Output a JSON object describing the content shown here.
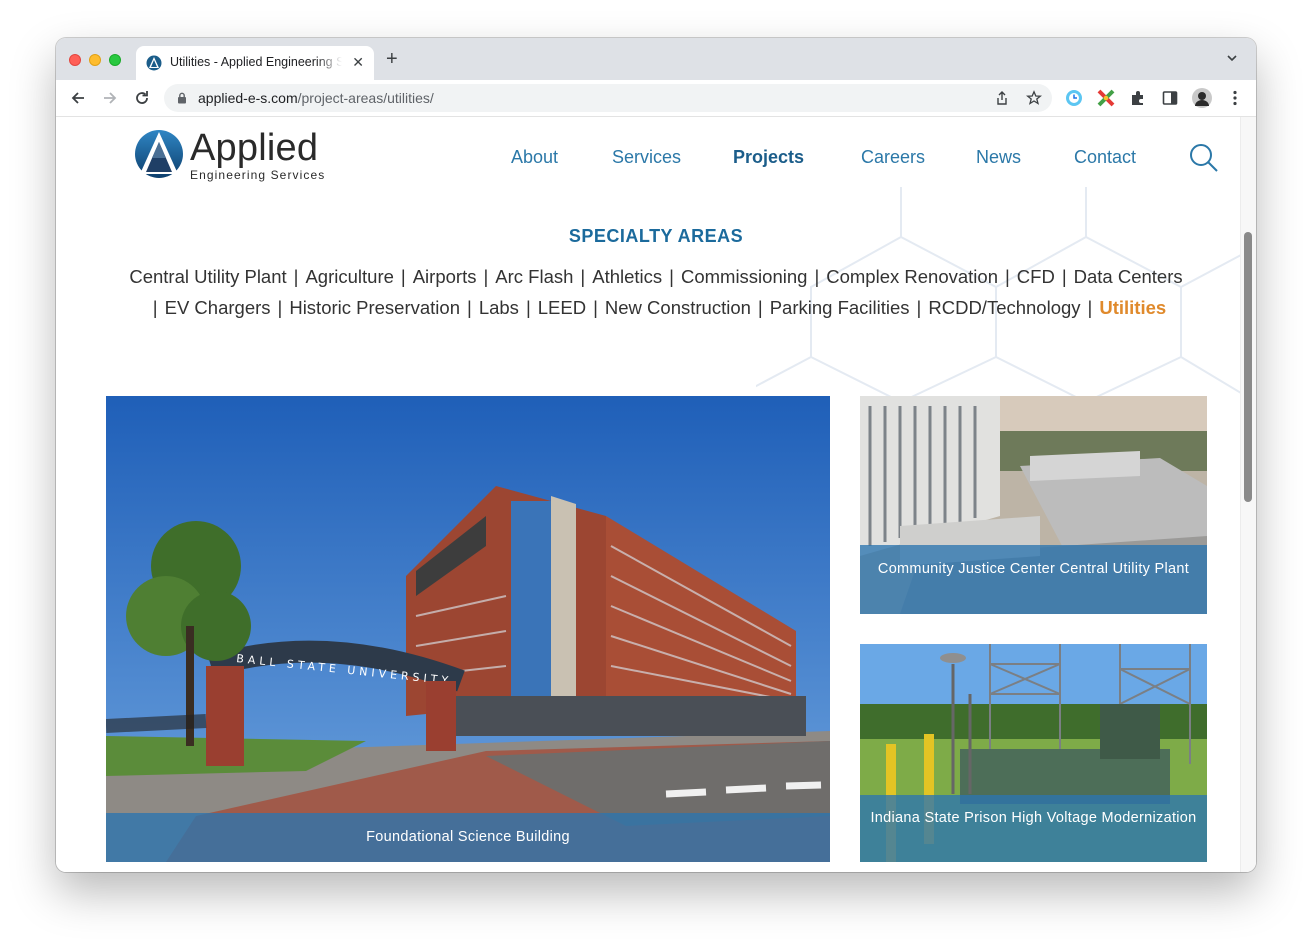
{
  "browser": {
    "tab_title": "Utilities - Applied Engineering Services",
    "new_tab_symbol": "+",
    "url_domain": "applied-e-s.com",
    "url_path": "/project-areas/utilities/"
  },
  "site": {
    "logo_word": "Applied",
    "logo_sub": "Engineering Services",
    "nav": [
      {
        "label": "About"
      },
      {
        "label": "Services"
      },
      {
        "label": "Projects",
        "active": true
      },
      {
        "label": "Careers"
      },
      {
        "label": "News"
      },
      {
        "label": "Contact"
      }
    ]
  },
  "specialty": {
    "heading": "SPECIALTY AREAS",
    "line1": [
      "Central Utility Plant",
      "Agriculture",
      "Airports",
      "Arc Flash",
      "Athletics",
      "Commissioning",
      "Complex Renovation",
      "CFD",
      "Data Centers"
    ],
    "line2": [
      "EV Chargers",
      "Historic Preservation",
      "Labs",
      "LEED",
      "New Construction",
      "Parking Facilities",
      "RCDD/Technology",
      "Utilities"
    ],
    "separator": "|",
    "current": "Utilities"
  },
  "projects": [
    {
      "title": "Foundational Science Building",
      "sign_text": "BALL STATE UNIVERSITY"
    },
    {
      "title": "Community Justice Center Central Utility Plant"
    },
    {
      "title": "Indiana State Prison High Voltage Modernization"
    }
  ],
  "colors": {
    "link_blue": "#2b78a8",
    "heading_blue": "#1b6a9c",
    "current_orange": "#e08a2c",
    "caption_overlay": "#2c75b0"
  }
}
